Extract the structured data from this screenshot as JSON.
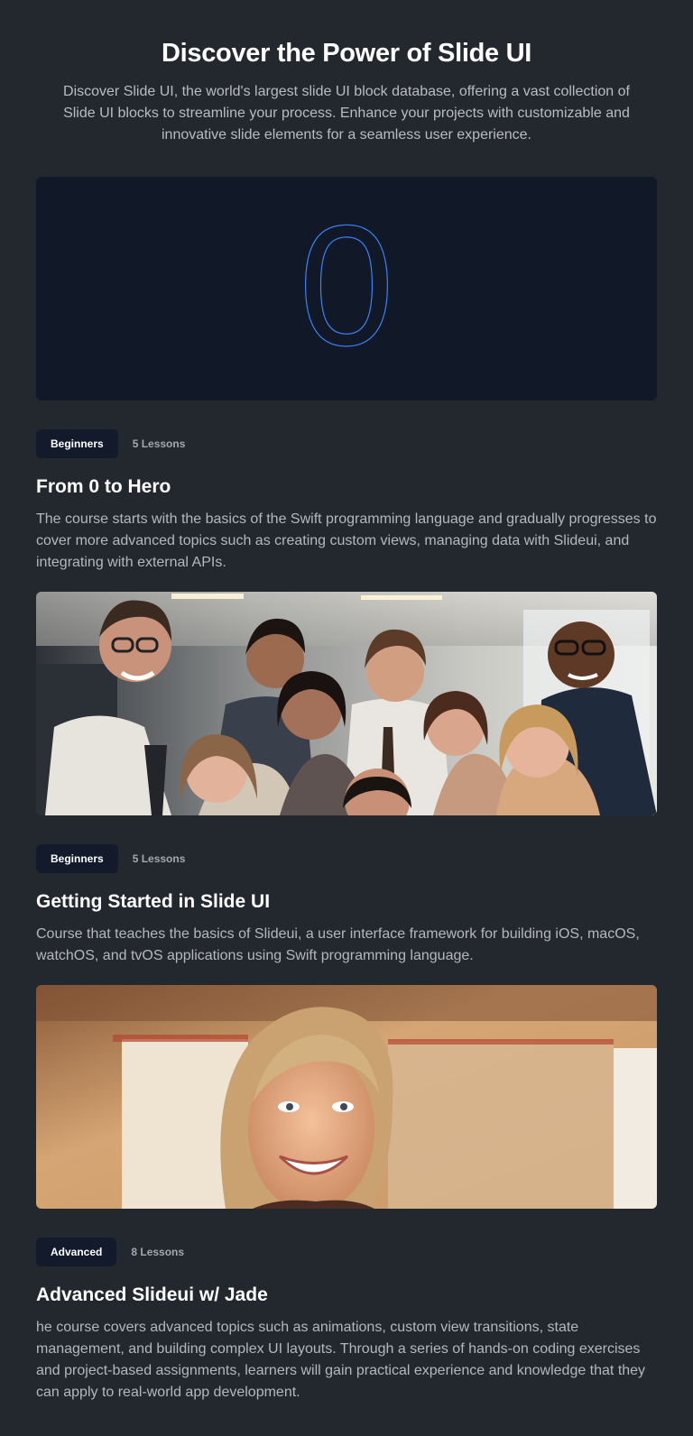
{
  "header": {
    "title": "Discover the Power of Slide UI",
    "subtitle": "Discover Slide UI, the world's largest slide UI block database, offering a vast collection of Slide UI blocks to streamline your process. Enhance your projects with customizable and innovative slide elements for a seamless user experience."
  },
  "courses": [
    {
      "media_type": "outlined-zero-graphic",
      "media_text": "0",
      "badge": "Beginners",
      "lessons": "5 Lessons",
      "title": "From 0 to Hero",
      "description": "The course starts with the basics of the Swift programming language and gradually progresses to cover more advanced topics such as creating custom views, managing data with Slideui, and integrating with external APIs."
    },
    {
      "media_type": "photo-group-of-smiling-professionals",
      "badge": "Beginners",
      "lessons": "5 Lessons",
      "title": "Getting Started in Slide UI",
      "description": "Course that teaches the basics of Slideui, a user interface framework for building iOS, macOS, watchOS, and tvOS applications using Swift programming language."
    },
    {
      "media_type": "photo-smiling-woman-in-office",
      "badge": "Advanced",
      "lessons": "8 Lessons",
      "title": "Advanced Slideui w/ Jade",
      "description": "he course covers advanced topics such as animations, custom view transitions, state management, and building complex UI layouts. Through a series of hands-on coding exercises and project-based assignments, learners will gain practical experience and knowledge that they can apply to real-world app development."
    }
  ],
  "colors": {
    "background": "#23272e",
    "card_dark": "#111827",
    "badge_bg": "#131a2b",
    "zero_outline": "#3b82f6"
  }
}
